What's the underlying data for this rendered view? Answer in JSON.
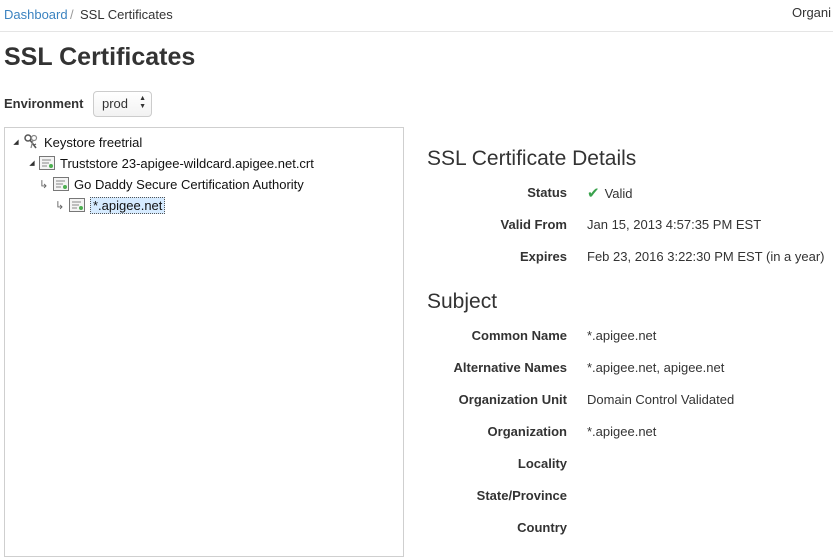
{
  "breadcrumb": {
    "link": "Dashboard",
    "separator": "/",
    "current": "SSL Certificates"
  },
  "header": {
    "org_label": "Organi"
  },
  "page_title": "SSL Certificates",
  "environment": {
    "label": "Environment",
    "selected": "prod"
  },
  "tree": {
    "keystore": "Keystore freetrial",
    "truststore": "Truststore 23-apigee-wildcard.apigee.net.crt",
    "authority": "Go Daddy Secure Certification Authority",
    "cert": "*.apigee.net"
  },
  "details": {
    "title": "SSL Certificate Details",
    "status": {
      "label": "Status",
      "value": "Valid",
      "color": "#3aa24d"
    },
    "valid_from": {
      "label": "Valid From",
      "value": "Jan 15, 2013 4:57:35 PM EST"
    },
    "expires": {
      "label": "Expires",
      "value": "Feb 23, 2016 3:22:30 PM EST (in a year)"
    }
  },
  "subject": {
    "title": "Subject",
    "common_name": {
      "label": "Common Name",
      "value": "*.apigee.net"
    },
    "alt_names": {
      "label": "Alternative Names",
      "value": "*.apigee.net, apigee.net"
    },
    "org_unit": {
      "label": "Organization Unit",
      "value": "Domain Control Validated"
    },
    "organization": {
      "label": "Organization",
      "value": "*.apigee.net"
    },
    "locality": {
      "label": "Locality",
      "value": ""
    },
    "state": {
      "label": "State/Province",
      "value": ""
    },
    "country": {
      "label": "Country",
      "value": ""
    }
  },
  "colors": {
    "link": "#3b83c0",
    "selection": "#d6ebff",
    "valid": "#3aa24d"
  }
}
